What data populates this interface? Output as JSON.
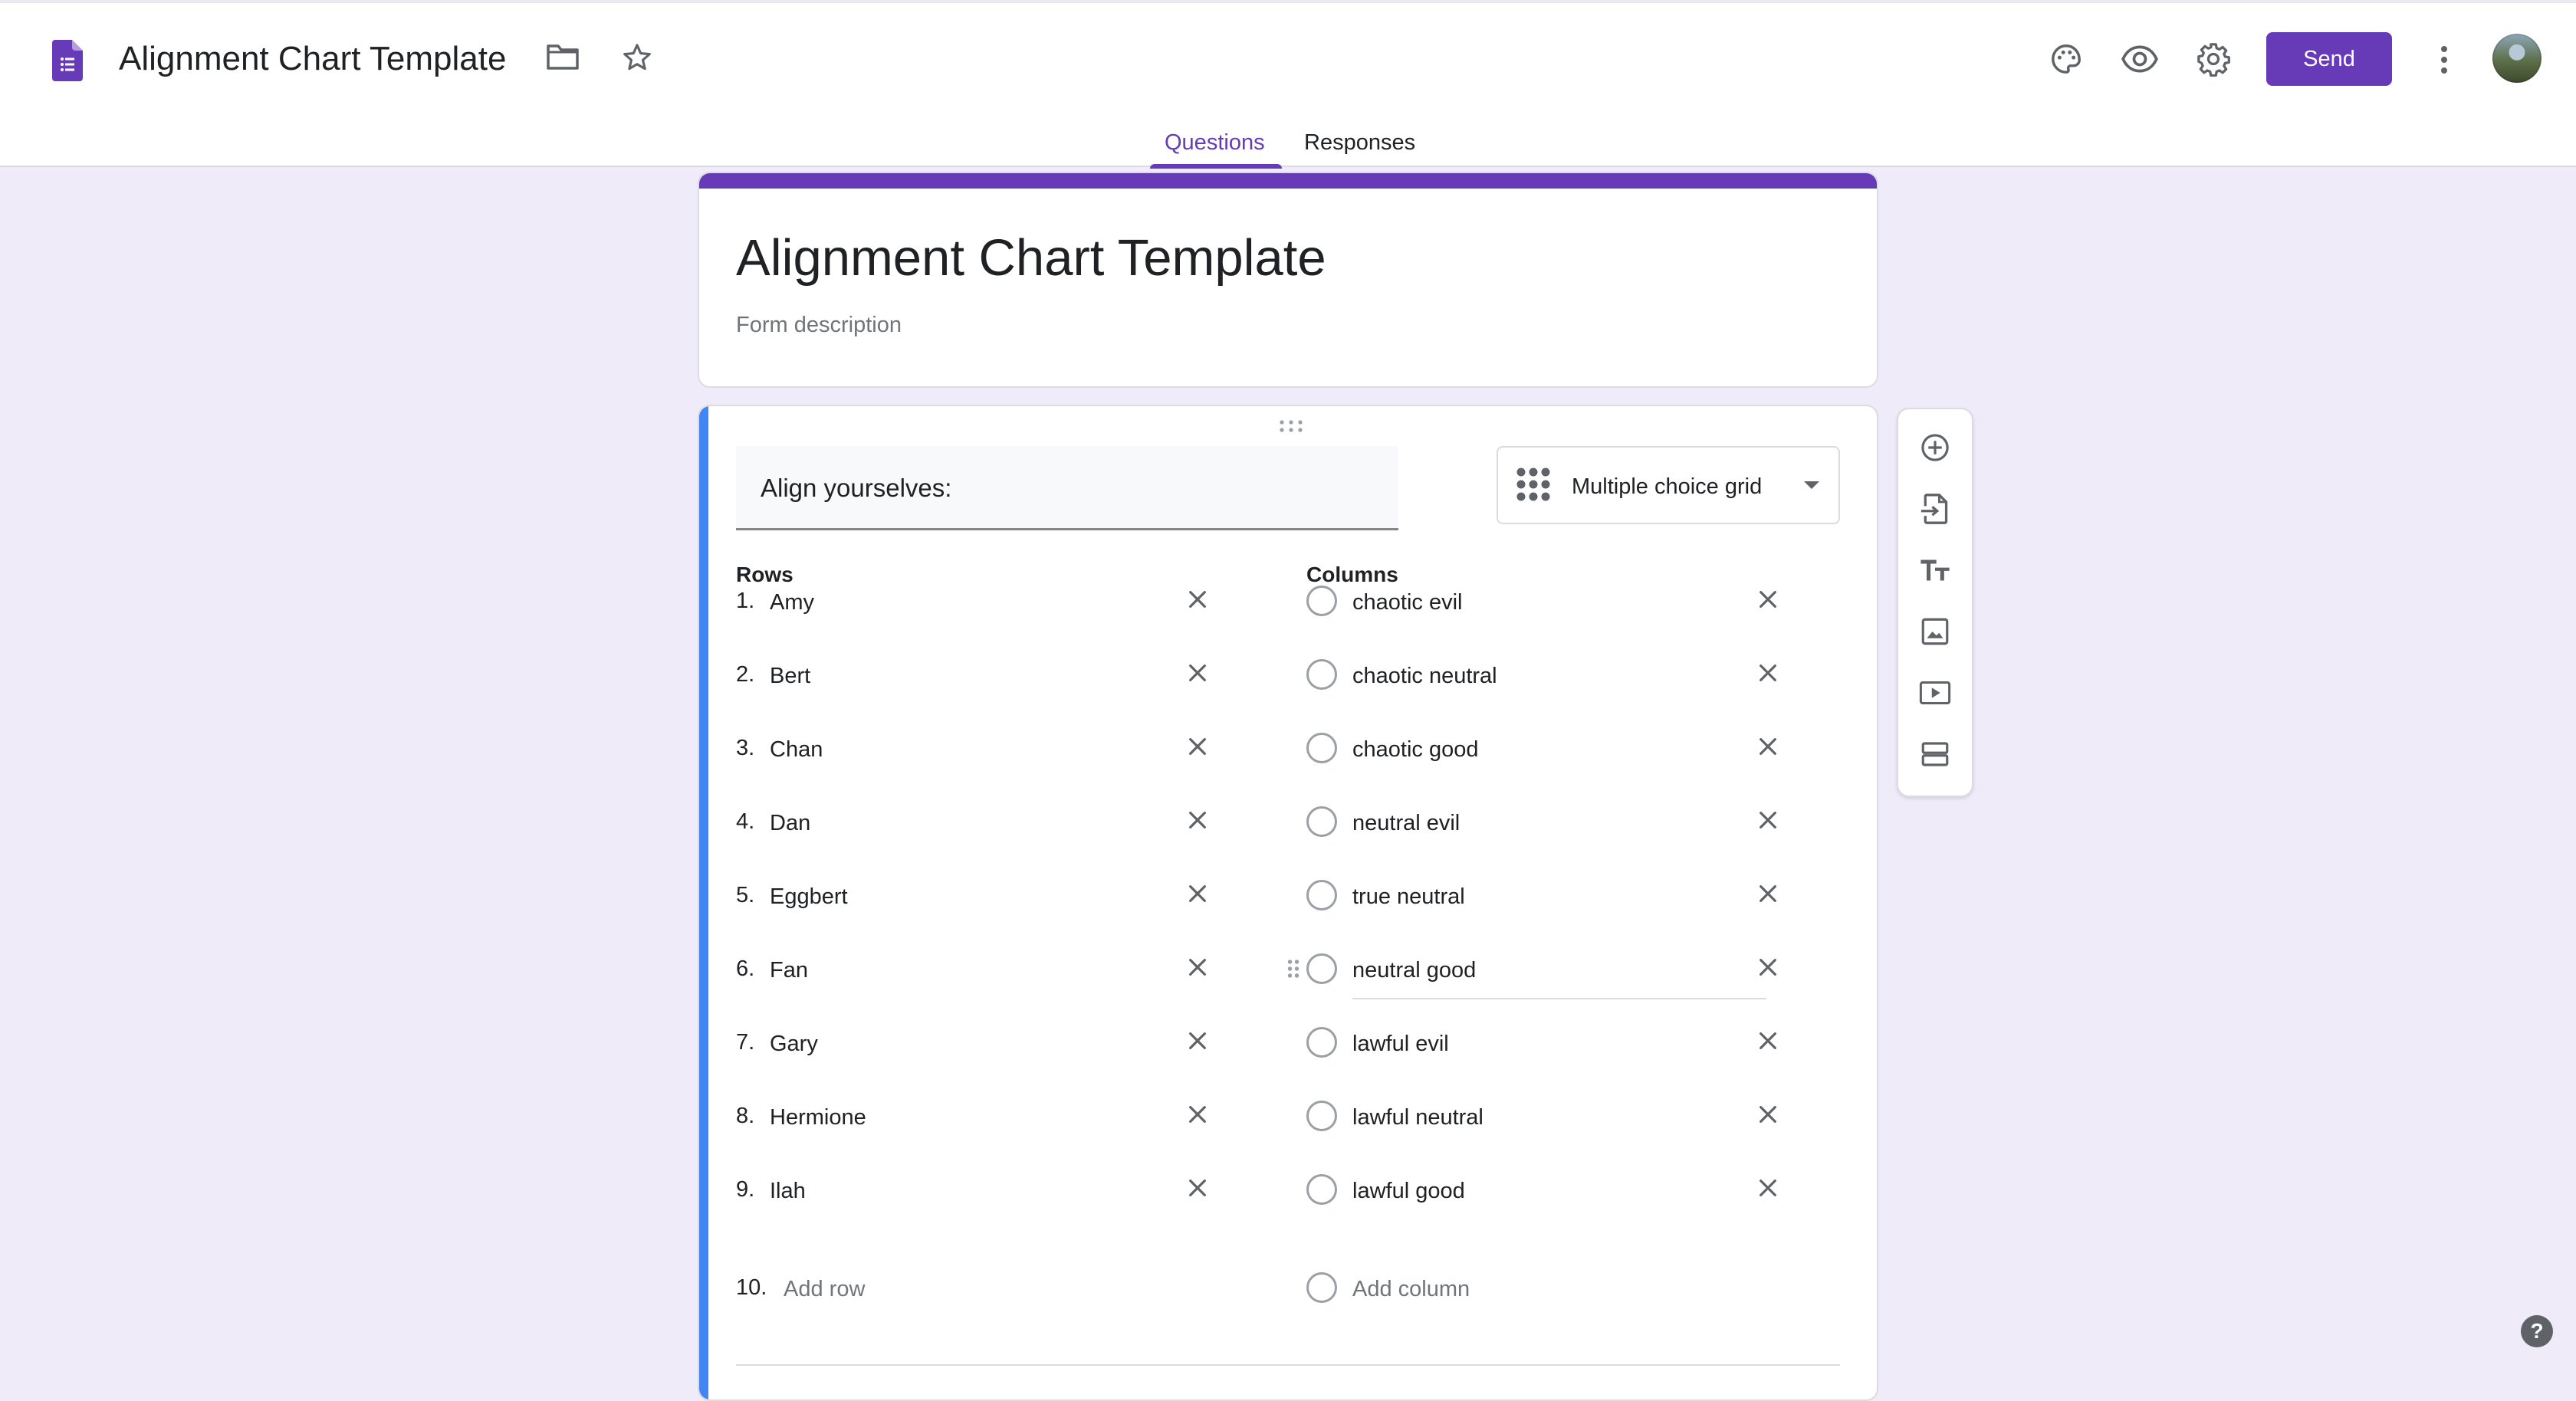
{
  "header": {
    "app_title": "Alignment Chart Template",
    "send_label": "Send",
    "icons": [
      "forms-doc-icon",
      "folder-icon",
      "star-icon",
      "palette-icon",
      "preview-eye-icon",
      "settings-gear-icon",
      "more-vert-icon",
      "avatar"
    ]
  },
  "tabs": [
    {
      "label": "Questions",
      "active": true
    },
    {
      "label": "Responses",
      "active": false
    }
  ],
  "form": {
    "title": "Alignment Chart Template",
    "description_placeholder": "Form description"
  },
  "question": {
    "text": "Align yourselves:",
    "type": "Multiple choice grid",
    "rows_heading": "Rows",
    "columns_heading": "Columns",
    "rows": [
      {
        "num": "1.",
        "label": "Amy"
      },
      {
        "num": "2.",
        "label": "Bert"
      },
      {
        "num": "3.",
        "label": "Chan"
      },
      {
        "num": "4.",
        "label": "Dan"
      },
      {
        "num": "5.",
        "label": "Eggbert"
      },
      {
        "num": "6.",
        "label": "Fan"
      },
      {
        "num": "7.",
        "label": "Gary"
      },
      {
        "num": "8.",
        "label": "Hermione"
      },
      {
        "num": "9.",
        "label": "Ilah"
      }
    ],
    "add_row": {
      "num": "10.",
      "label": "Add row"
    },
    "columns": [
      {
        "label": "chaotic evil"
      },
      {
        "label": "chaotic neutral"
      },
      {
        "label": "chaotic good"
      },
      {
        "label": "neutral evil"
      },
      {
        "label": "true neutral"
      },
      {
        "label": "neutral good",
        "focused": true
      },
      {
        "label": "lawful evil"
      },
      {
        "label": "lawful neutral"
      },
      {
        "label": "lawful good"
      }
    ],
    "add_column": "Add column"
  },
  "side_toolbar": [
    "add-question-icon",
    "import-questions-icon",
    "add-title-icon",
    "add-image-icon",
    "add-video-icon",
    "add-section-icon"
  ],
  "help_label": "?",
  "colors": {
    "accent": "#673ab7",
    "active_question": "#4285f4",
    "background": "#f0ebf8"
  }
}
